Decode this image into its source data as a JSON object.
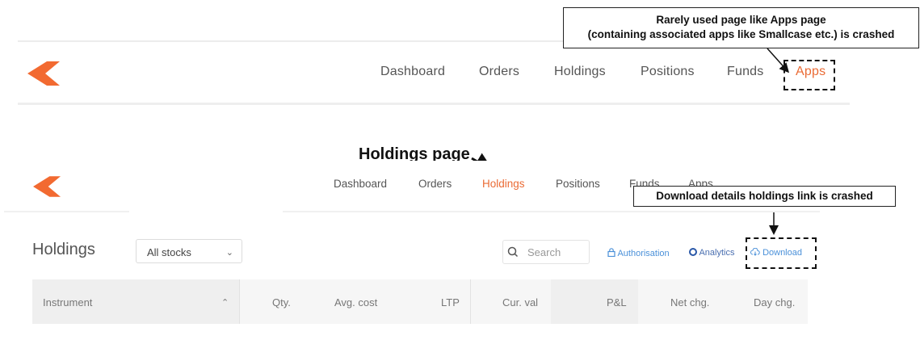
{
  "top_nav": {
    "items": [
      "Dashboard",
      "Orders",
      "Holdings",
      "Positions",
      "Funds",
      "Apps"
    ],
    "active": "Apps"
  },
  "callouts": {
    "apps_crash": {
      "line1": "Rarely used page like Apps page",
      "line2": "(containing associated apps like Smallcase etc.) is crashed"
    },
    "holdings_label": "Holdings page",
    "download_crash": "Download details holdings link is crashed"
  },
  "holdings_nav": {
    "items": [
      "Dashboard",
      "Orders",
      "Holdings",
      "Positions",
      "Funds",
      "Apps"
    ],
    "active": "Holdings"
  },
  "holdings": {
    "title": "Holdings",
    "filter_value": "All stocks",
    "search_placeholder": "Search",
    "links": {
      "authorisation": "Authorisation",
      "analytics": "Analytics",
      "download": "Download"
    },
    "columns": [
      "Instrument",
      "Qty.",
      "Avg. cost",
      "LTP",
      "Cur. val",
      "P&L",
      "Net chg.",
      "Day chg."
    ]
  },
  "colors": {
    "brand": "#f26a31",
    "active_link": "#ea6b35",
    "link_blue": "#4a90d9"
  }
}
